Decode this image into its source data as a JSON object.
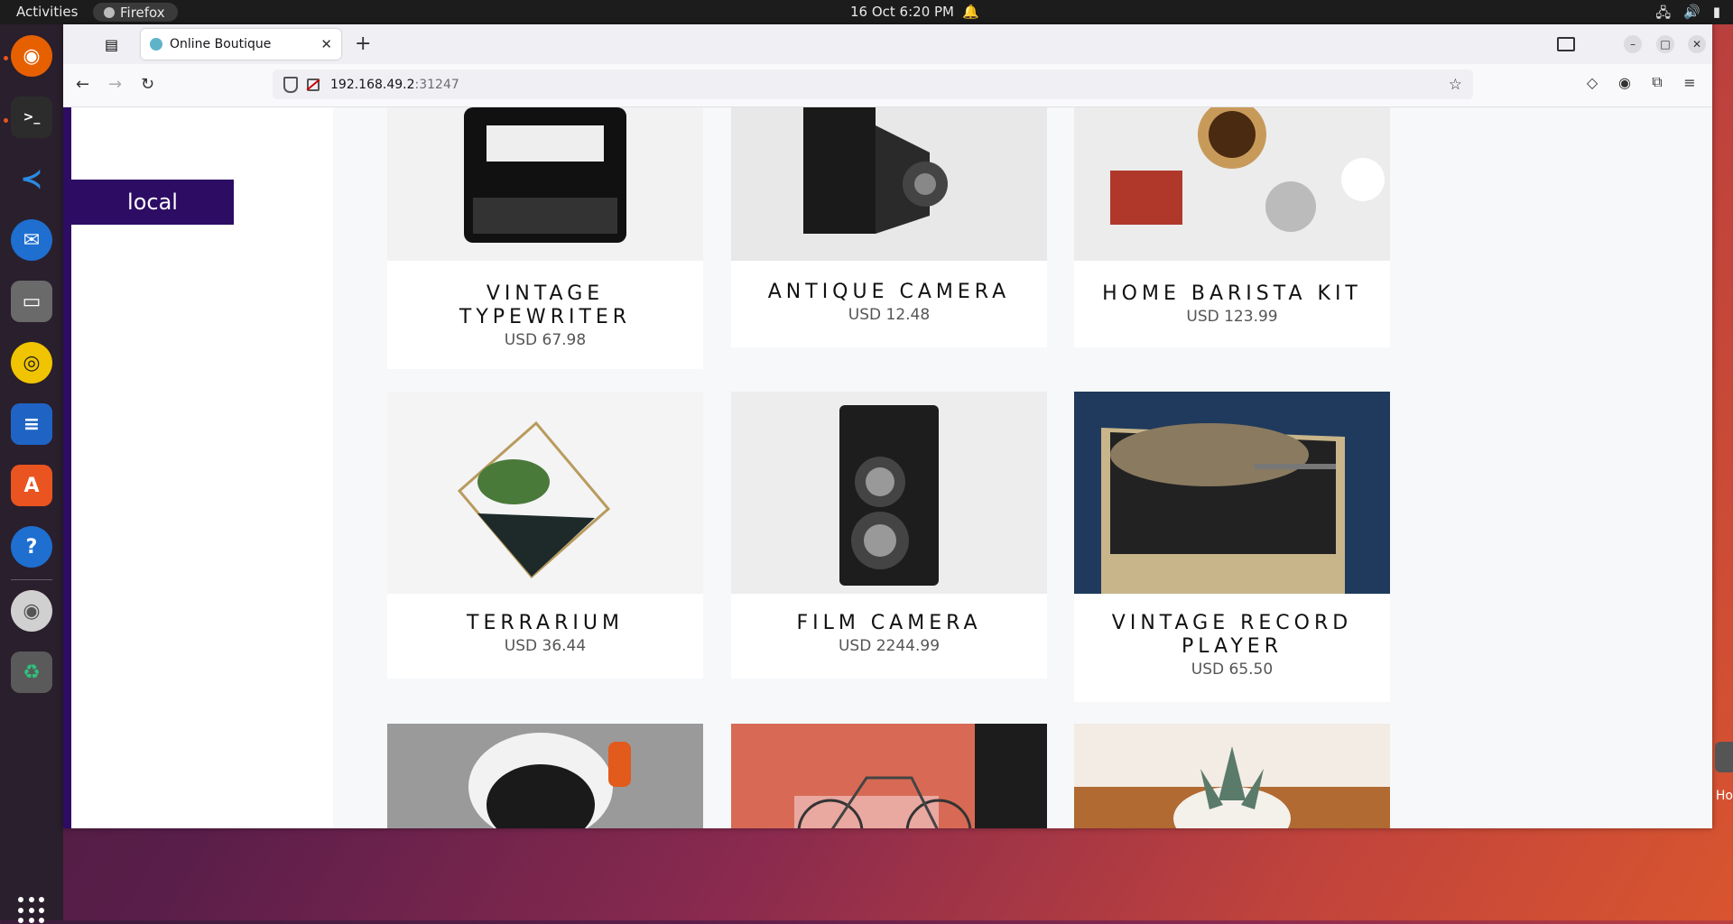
{
  "topbar": {
    "activities": "Activities",
    "app_name": "Firefox",
    "datetime": "16 Oct  6:20 PM"
  },
  "browser": {
    "tab_title": "Online Boutique",
    "url_host": "192.168.49.2",
    "url_port": ":31247"
  },
  "page": {
    "cluster_label": "local",
    "products": [
      {
        "name": "VINTAGE TYPEWRITER",
        "price": "USD 67.98"
      },
      {
        "name": "ANTIQUE CAMERA",
        "price": "USD 12.48"
      },
      {
        "name": "HOME BARISTA KIT",
        "price": "USD 123.99"
      },
      {
        "name": "TERRARIUM",
        "price": "USD 36.44"
      },
      {
        "name": "FILM CAMERA",
        "price": "USD 2244.99"
      },
      {
        "name": "VINTAGE RECORD PLAYER",
        "price": "USD 65.50"
      }
    ]
  },
  "desktop": {
    "side_label": "Ho"
  },
  "colors": {
    "brand": "#2d0c64",
    "ubuntu_orange": "#e95420"
  }
}
